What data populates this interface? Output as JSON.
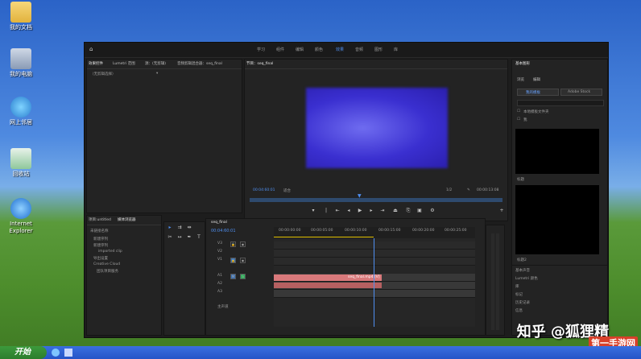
{
  "desktop": {
    "icons": [
      {
        "label": "我的文档",
        "icon": "folder-icon"
      },
      {
        "label": "我的电脑",
        "icon": "computer-icon"
      },
      {
        "label": "网上邻居",
        "icon": "network-icon"
      },
      {
        "label": "回收站",
        "icon": "recycle-bin-icon"
      },
      {
        "label": "Internet Explorer",
        "icon": "ie-icon"
      }
    ]
  },
  "taskbar": {
    "start_label": "开始"
  },
  "watermark": {
    "text": "知乎 @狐狸精",
    "badge": "第一手游网"
  },
  "premiere": {
    "workspaces": [
      "学习",
      "组件",
      "编辑",
      "颜色",
      "效果",
      "音频",
      "图形",
      "库"
    ],
    "active_workspace": "效果",
    "source_tabs": [
      "效果控件",
      "Lumetri 范围",
      "源：(无剪辑)",
      "音频剪辑混合器：seq_final"
    ],
    "source_placeholder": "（无剪辑选择）",
    "program_tab": "节目：seq_final",
    "program_timecode": "00:04:60:01",
    "program_fit": "适合",
    "program_quality": "1/2",
    "program_duration": "00:00:13:08",
    "project_tabs": [
      "项目:untitled",
      "媒体浏览器"
    ],
    "project_items": [
      "未链接名称",
      "新建序列",
      "imported clip",
      "导出设置",
      "Creative Cloud",
      "团队项目服务"
    ],
    "timeline_tab": "seq_final",
    "timeline_timecode": "00:04:60:01",
    "timeline_ruler": [
      "00:00:00:00",
      "00:00:05:00",
      "00:00:10:00",
      "00:00:15:00",
      "00:00:20:00",
      "00:00:25:00"
    ],
    "tracks": [
      "V3",
      "V2",
      "V1",
      "A1",
      "A2",
      "A3",
      "主声道"
    ],
    "clip_label": "seq_final.mp4 [V]",
    "right_panel_title": "基本图形",
    "right_tabs": [
      "浏览",
      "编辑"
    ],
    "right_buttons": [
      "我的模板",
      "Adobe Stock"
    ],
    "right_checks": [
      "本地模板文件夹",
      "我"
    ],
    "template_names": [
      "标题",
      "标题2"
    ],
    "lower_list": [
      "基本声音",
      "Lumetri 颜色",
      "库",
      "标记",
      "历史记录",
      "信息"
    ]
  }
}
